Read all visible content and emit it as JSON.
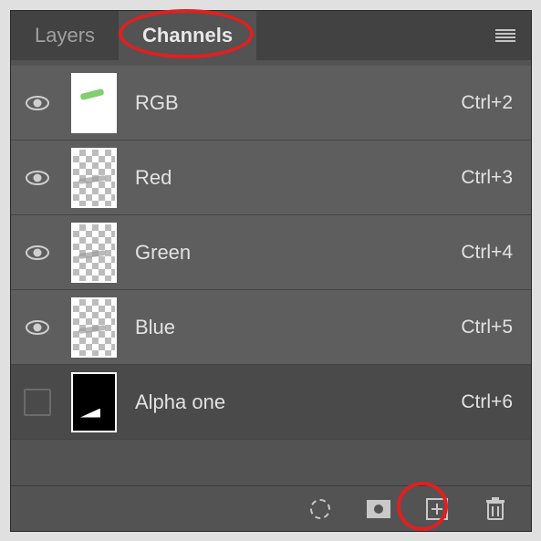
{
  "tabs": {
    "layers_label": "Layers",
    "channels_label": "Channels",
    "active": "channels"
  },
  "channels": [
    {
      "name": "RGB",
      "shortcut": "Ctrl+2",
      "visible": true,
      "thumb": "rgb",
      "selected": true
    },
    {
      "name": "Red",
      "shortcut": "Ctrl+3",
      "visible": true,
      "thumb": "red",
      "selected": true
    },
    {
      "name": "Green",
      "shortcut": "Ctrl+4",
      "visible": true,
      "thumb": "green",
      "selected": true
    },
    {
      "name": "Blue",
      "shortcut": "Ctrl+5",
      "visible": true,
      "thumb": "blue",
      "selected": true
    },
    {
      "name": "Alpha one",
      "shortcut": "Ctrl+6",
      "visible": false,
      "thumb": "alpha",
      "selected": false
    }
  ],
  "footer_icons": {
    "load_selection": "load-selection-icon",
    "save_mask": "save-selection-mask-icon",
    "new_channel": "new-channel-icon",
    "delete": "trash-icon"
  },
  "annotations": {
    "channels_tab_circled": true,
    "new_channel_button_circled": true
  },
  "colors": {
    "panel_bg": "#535353",
    "tabbar_bg": "#424242",
    "row_bg": "#5e5e5e",
    "row_unselected_bg": "#4a4a4a",
    "text": "#e2e2e2",
    "annotation": "#e02020"
  }
}
